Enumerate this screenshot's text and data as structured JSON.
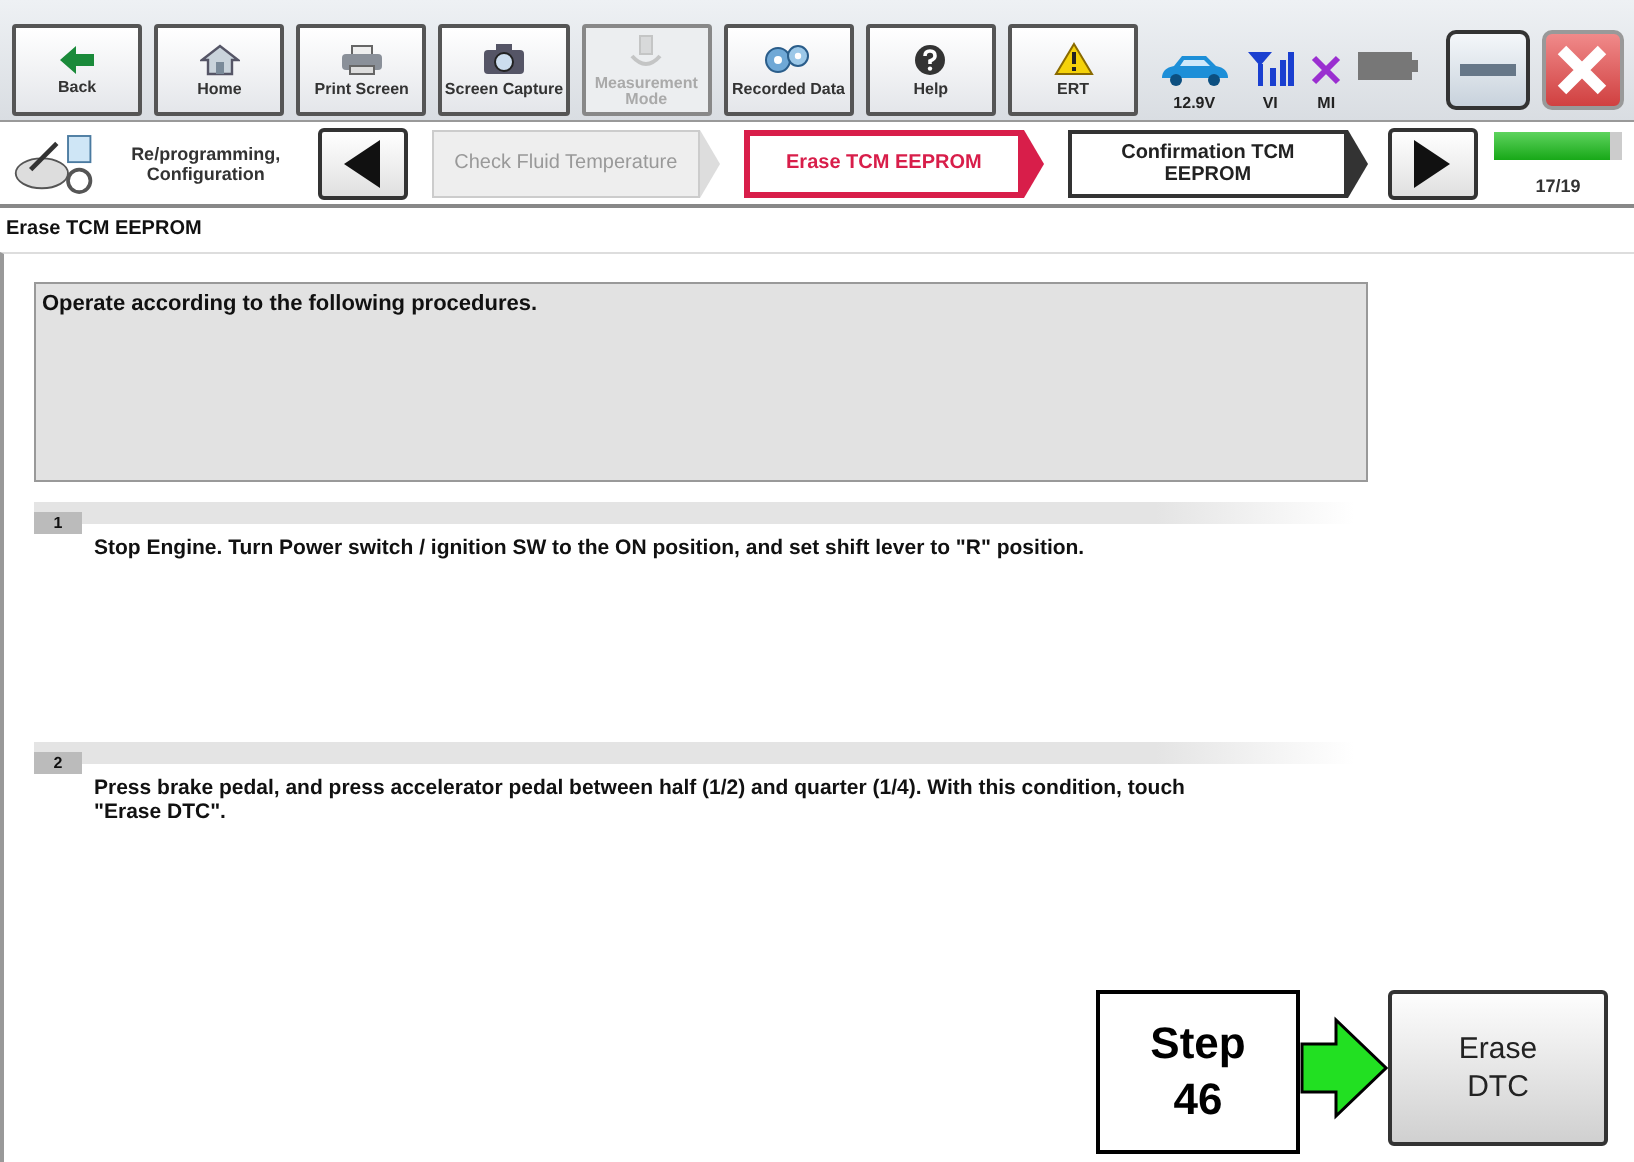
{
  "toolbar": {
    "buttons": [
      {
        "label": "Back",
        "disabled": false
      },
      {
        "label": "Home",
        "disabled": false
      },
      {
        "label": "Print Screen",
        "disabled": false
      },
      {
        "label": "Screen Capture",
        "disabled": false
      },
      {
        "label": "Measurement Mode",
        "disabled": true
      },
      {
        "label": "Recorded Data",
        "disabled": false
      },
      {
        "label": "Help",
        "disabled": false
      },
      {
        "label": "ERT",
        "disabled": false
      }
    ],
    "status": [
      {
        "label": "12.9V"
      },
      {
        "label": "VI"
      },
      {
        "label": "MI"
      }
    ]
  },
  "navigation": {
    "section": "Re/programming, Configuration",
    "steps": [
      {
        "label": "Check Fluid Temperature",
        "selected": false,
        "disabled": true
      },
      {
        "label": "Erase TCM EEPROM",
        "selected": true,
        "disabled": false
      },
      {
        "label": "Confirmation TCM EEPROM",
        "selected": false,
        "disabled": false
      }
    ],
    "progress": {
      "level": 0.9,
      "reading": "17/19"
    }
  },
  "page_title": "Erase TCM EEPROM",
  "instruction": "Operate according to the following procedures.",
  "procedure": [
    {
      "number": "1",
      "text": "Stop Engine. Turn Power switch / ignition SW to the ON position, and set shift lever to \"R\" position."
    },
    {
      "number": "2",
      "text": "Press brake pedal, and press accelerator pedal between half (1/2) and quarter (1/4). With this condition, touch \"Erase DTC\"."
    }
  ],
  "action_button": "Erase DTC",
  "callout": {
    "label": "Step 46"
  }
}
